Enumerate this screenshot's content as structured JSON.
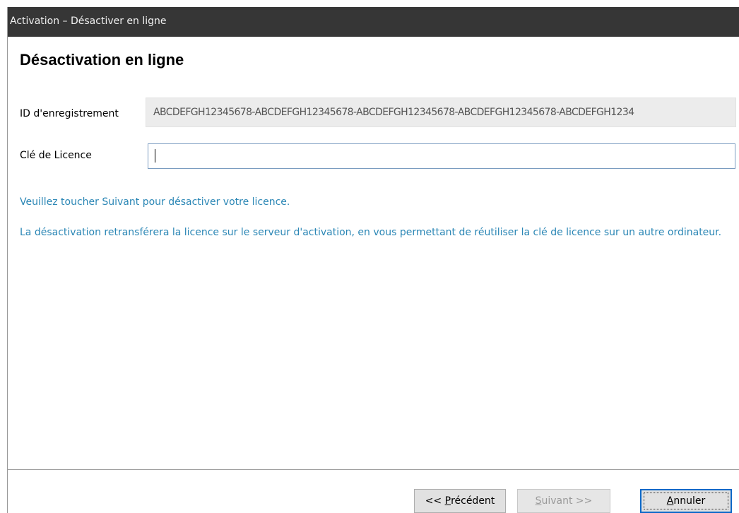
{
  "window": {
    "title": "Activation – Désactiver en ligne"
  },
  "page": {
    "heading": "Désactivation en ligne"
  },
  "registration": {
    "label": "ID d'enregistrement",
    "value": "ABCDEFGH12345678-ABCDEFGH12345678-ABCDEFGH12345678-ABCDEFGH12345678-ABCDEFGH1234"
  },
  "license": {
    "label": "Clé de Licence",
    "value": ""
  },
  "messages": {
    "instruction": "Veuillez toucher Suivant pour désactiver votre licence.",
    "explanation": "La désactivation retransférera la licence sur le serveur d'activation, en vous permettant de réutiliser la clé de licence sur un autre ordinateur."
  },
  "buttons": {
    "previous": {
      "prefix": "<< ",
      "accel": "P",
      "rest": "récédent",
      "enabled": true
    },
    "next": {
      "accel": "S",
      "rest": "uivant >>",
      "enabled": false
    },
    "cancel": {
      "accel": "A",
      "rest": "nnuler",
      "enabled": true
    }
  },
  "colors": {
    "titlebar": "#363636",
    "info_text": "#2a86b5",
    "focus_border": "#0b68c8"
  }
}
